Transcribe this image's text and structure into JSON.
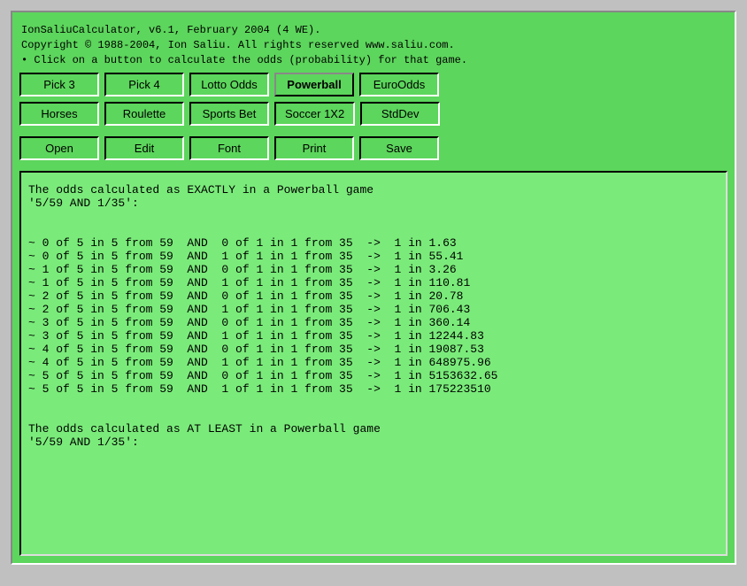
{
  "title": {
    "line1": "IonSaliuCalculator, v6.1, February 2004 (4 WE).",
    "line2": "Copyright © 1988-2004, Ion Saliu. All rights reserved www.saliu.com.",
    "line3": "• Click on a button to calculate the odds (probability) for that game."
  },
  "buttons_row1": [
    {
      "id": "pick3",
      "label": "Pick 3",
      "active": false
    },
    {
      "id": "pick4",
      "label": "Pick 4",
      "active": false
    },
    {
      "id": "lotto-odds",
      "label": "Lotto Odds",
      "active": false
    },
    {
      "id": "powerball",
      "label": "Powerball",
      "active": true
    },
    {
      "id": "euro-odds",
      "label": "EuroOdds",
      "active": false
    }
  ],
  "buttons_row2": [
    {
      "id": "horses",
      "label": "Horses",
      "active": false
    },
    {
      "id": "roulette",
      "label": "Roulette",
      "active": false
    },
    {
      "id": "sports-bet",
      "label": "Sports Bet",
      "active": false
    },
    {
      "id": "soccer-1x2",
      "label": "Soccer 1X2",
      "active": false
    },
    {
      "id": "std-dev",
      "label": "StdDev",
      "active": false
    }
  ],
  "buttons_row3": [
    {
      "id": "open",
      "label": "Open",
      "active": false
    },
    {
      "id": "edit",
      "label": "Edit",
      "active": false
    },
    {
      "id": "font",
      "label": "Font",
      "active": false
    },
    {
      "id": "print",
      "label": "Print",
      "active": false
    },
    {
      "id": "save",
      "label": "Save",
      "active": false
    }
  ],
  "output": "The odds calculated as EXACTLY in a Powerball game\n'5/59 AND 1/35':\n\n\n~ 0 of 5 in 5 from 59  AND  0 of 1 in 1 from 35  ->  1 in 1.63\n~ 0 of 5 in 5 from 59  AND  1 of 1 in 1 from 35  ->  1 in 55.41\n~ 1 of 5 in 5 from 59  AND  0 of 1 in 1 from 35  ->  1 in 3.26\n~ 1 of 5 in 5 from 59  AND  1 of 1 in 1 from 35  ->  1 in 110.81\n~ 2 of 5 in 5 from 59  AND  0 of 1 in 1 from 35  ->  1 in 20.78\n~ 2 of 5 in 5 from 59  AND  1 of 1 in 1 from 35  ->  1 in 706.43\n~ 3 of 5 in 5 from 59  AND  0 of 1 in 1 from 35  ->  1 in 360.14\n~ 3 of 5 in 5 from 59  AND  1 of 1 in 1 from 35  ->  1 in 12244.83\n~ 4 of 5 in 5 from 59  AND  0 of 1 in 1 from 35  ->  1 in 19087.53\n~ 4 of 5 in 5 from 59  AND  1 of 1 in 1 from 35  ->  1 in 648975.96\n~ 5 of 5 in 5 from 59  AND  0 of 1 in 1 from 35  ->  1 in 5153632.65\n~ 5 of 5 in 5 from 59  AND  1 of 1 in 1 from 35  ->  1 in 175223510\n\n\nThe odds calculated as AT LEAST in a Powerball game\n'5/59 AND 1/35':\n"
}
